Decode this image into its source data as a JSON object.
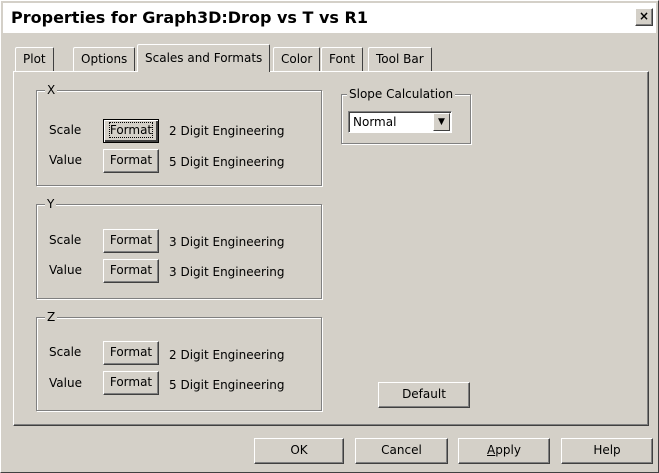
{
  "window": {
    "title": "Properties for Graph3D:Drop vs T vs R1",
    "close_glyph": "×"
  },
  "tabs": [
    {
      "label": "Plot"
    },
    {
      "label": "Options"
    },
    {
      "label": "Scales and Formats",
      "active": true
    },
    {
      "label": "Color"
    },
    {
      "label": "Font"
    },
    {
      "label": "Tool Bar"
    }
  ],
  "groups": {
    "x": {
      "legend": "X",
      "scale": {
        "label": "Scale",
        "button": "Format",
        "format": "2 Digit Engineering"
      },
      "value": {
        "label": "Value",
        "button": "Format",
        "format": "5 Digit Engineering"
      }
    },
    "y": {
      "legend": "Y",
      "scale": {
        "label": "Scale",
        "button": "Format",
        "format": "3 Digit Engineering"
      },
      "value": {
        "label": "Value",
        "button": "Format",
        "format": "3 Digit Engineering"
      }
    },
    "z": {
      "legend": "Z",
      "scale": {
        "label": "Scale",
        "button": "Format",
        "format": "2 Digit Engineering"
      },
      "value": {
        "label": "Value",
        "button": "Format",
        "format": "5 Digit Engineering"
      }
    }
  },
  "slope": {
    "legend": "Slope Calculation",
    "selected": "Normal",
    "arrow_glyph": "▼"
  },
  "default_button": "Default",
  "footer": {
    "ok": "OK",
    "cancel": "Cancel",
    "apply": "Apply",
    "help": "Help"
  },
  "colors": {
    "face": "#d4d0c8",
    "title_bg": "#ffffff"
  }
}
